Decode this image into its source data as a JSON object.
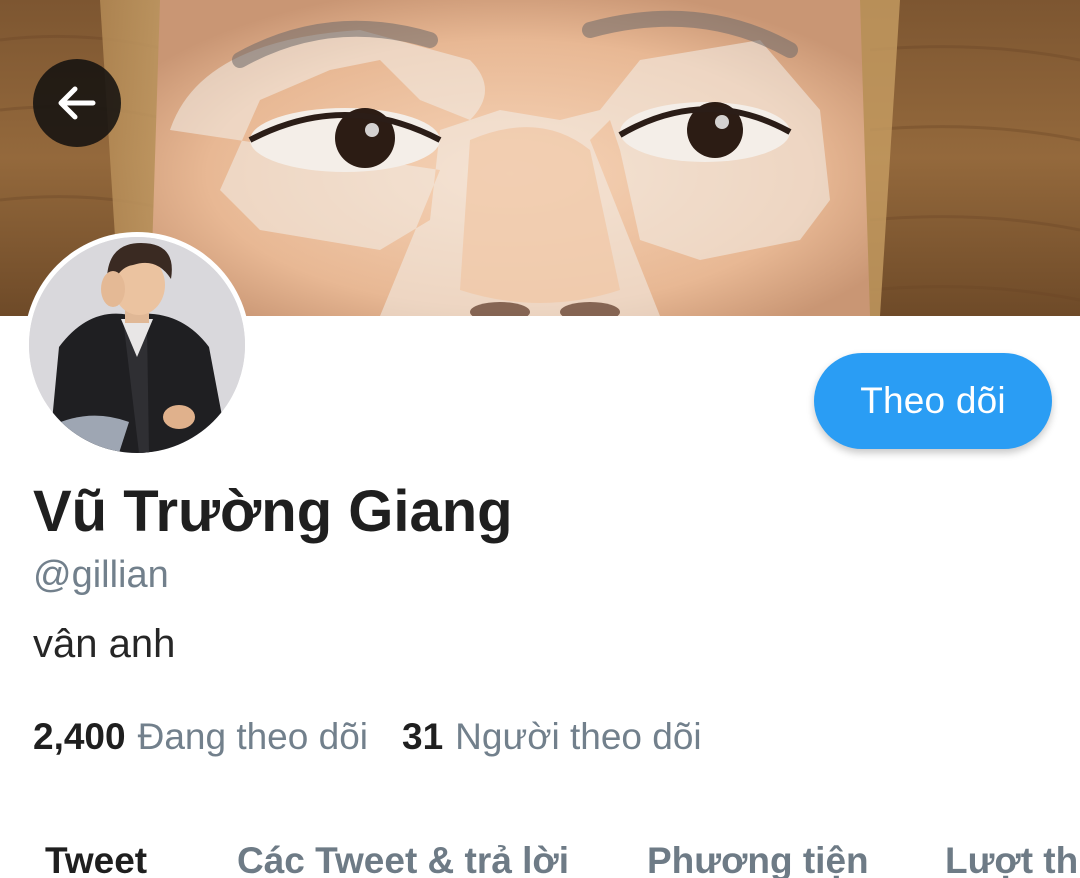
{
  "header": {
    "back_icon": "arrow-left-icon",
    "banner_description_colors": {
      "wood": "#8a6238",
      "skin": "#f0c9a8"
    }
  },
  "profile": {
    "display_name": "Vũ Trường Giang",
    "handle": "@gillian",
    "bio": "vân anh",
    "follow_label": "Theo dõi",
    "accent_color": "#2a9df4"
  },
  "stats": {
    "following_count": "2,400",
    "following_label": "Đang theo dõi",
    "followers_count": "31",
    "followers_label": "Người theo dõi"
  },
  "tabs": [
    {
      "label": "Tweet",
      "active": true
    },
    {
      "label": "Các Tweet & trả lời",
      "active": false
    },
    {
      "label": "Phương tiện",
      "active": false
    },
    {
      "label": "Lượt thích",
      "active": false
    }
  ]
}
